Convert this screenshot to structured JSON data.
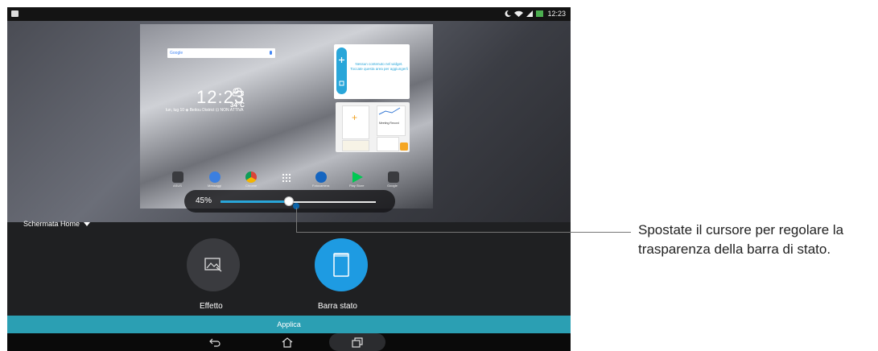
{
  "status_bar": {
    "time": "12:23"
  },
  "preview": {
    "search_brand": "Google",
    "clock_time": "12:23",
    "temperature": "34°C",
    "date_line": "lun, lug 10  ◈ Beitou District  ⊡ NON ATTIVA",
    "widget_message": "Nessun contenuto nel widget. Toccate questa area per aggiungerli",
    "widget_card_title": "Meeting Record",
    "dock_labels": [
      "ASUS",
      "Messaggi",
      "Chrome",
      "",
      "Fotocamera",
      "Play Store",
      "Google"
    ]
  },
  "slider": {
    "value_label": "45%",
    "value_fraction": 0.45
  },
  "section": {
    "label": "Schermata Home"
  },
  "options": [
    {
      "label": "Effetto",
      "icon": "image-effect-icon"
    },
    {
      "label": "Barra stato",
      "icon": "status-bar-icon"
    }
  ],
  "apply_label": "Applica",
  "callout": {
    "line1": "Spostate il cursore per regolare la",
    "line2": "trasparenza della barra di stato."
  },
  "colors": {
    "accent": "#1e9be2",
    "apply_bar": "#2b9fb3",
    "slider_fill": "#29a6d9"
  }
}
